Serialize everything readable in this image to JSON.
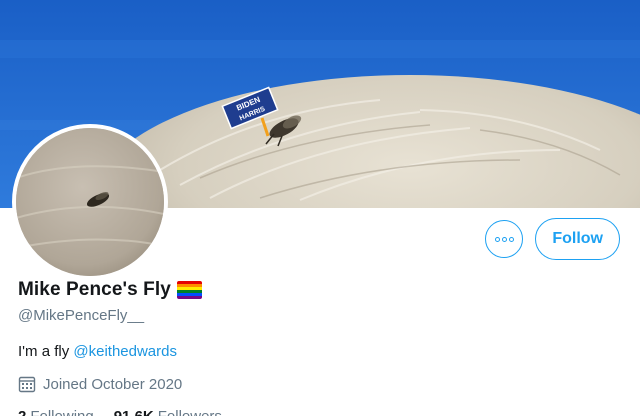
{
  "banner": {
    "sign_line1": "BIDEN",
    "sign_line2": "HARRIS"
  },
  "actions": {
    "more_icon": "more-horizontal-icon",
    "follow_label": "Follow"
  },
  "profile": {
    "name": "Mike Pence's Fly",
    "name_badge_icon": "rainbow-flag-icon",
    "handle": "@MikePenceFly__",
    "bio_text": "I'm a fly ",
    "bio_mention": "@keithedwards",
    "joined_icon": "calendar-icon",
    "joined": "Joined October 2020"
  },
  "stats": {
    "following_count": "2",
    "following_label": "Following",
    "followers_count": "91.6K",
    "followers_label": "Followers"
  },
  "colors": {
    "accent": "#1da1f2",
    "secondary_text": "#657786",
    "banner_blue": "#2a72d6",
    "flag": [
      "#e40303",
      "#ff8c00",
      "#ffed00",
      "#008026",
      "#004dff",
      "#750787"
    ]
  }
}
